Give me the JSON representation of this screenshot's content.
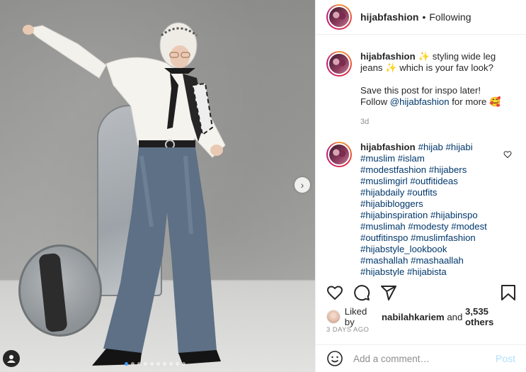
{
  "header": {
    "username": "hijabfashion",
    "separator": "•",
    "follow_status": "Following"
  },
  "caption": {
    "username": "hijabfashion",
    "line1": "✨ styling wide leg",
    "line2": "jeans ✨ which is your fav look?",
    "line3": "Save this post for inspo later!",
    "line4_prefix": "Follow",
    "line4_mention": "@hijabfashion",
    "line4_suffix": "for more 🥰",
    "time": "3d"
  },
  "hashtag_comment": {
    "username": "hijabfashion",
    "lines": [
      "#hijab #hijabi",
      "#muslim #islam",
      "#modestfashion #hijabers",
      "#muslimgirl #outfitideas",
      "#hijabdaily #outfits",
      "#hijabibloggers",
      "#hijabinspiration #hijabinspo",
      "#muslimah #modesty #modest",
      "#outfitinspo #muslimfashion",
      "#hijabstyle_lookbook",
      "#mashallah #mashaallah",
      "#hijabstyle #hijabista"
    ]
  },
  "likes": {
    "prefix": "Liked by",
    "user": "nabilahkariem",
    "connector": "and",
    "count": "3,535 others"
  },
  "date": "3 DAYS AGO",
  "comment_box": {
    "placeholder": "Add a comment…",
    "post_label": "Post"
  },
  "icons": {
    "like": "heart-icon",
    "comment": "comment-icon",
    "share": "paper-plane-icon",
    "save": "bookmark-icon",
    "emoji": "smiley-icon",
    "next": "chevron-right-icon",
    "tag": "user-tag-icon"
  },
  "carousel": {
    "total": 10,
    "active": 1
  },
  "colors": {
    "link": "#00376b",
    "accent": "#3897f0",
    "post_disabled": "#b2dffc"
  }
}
